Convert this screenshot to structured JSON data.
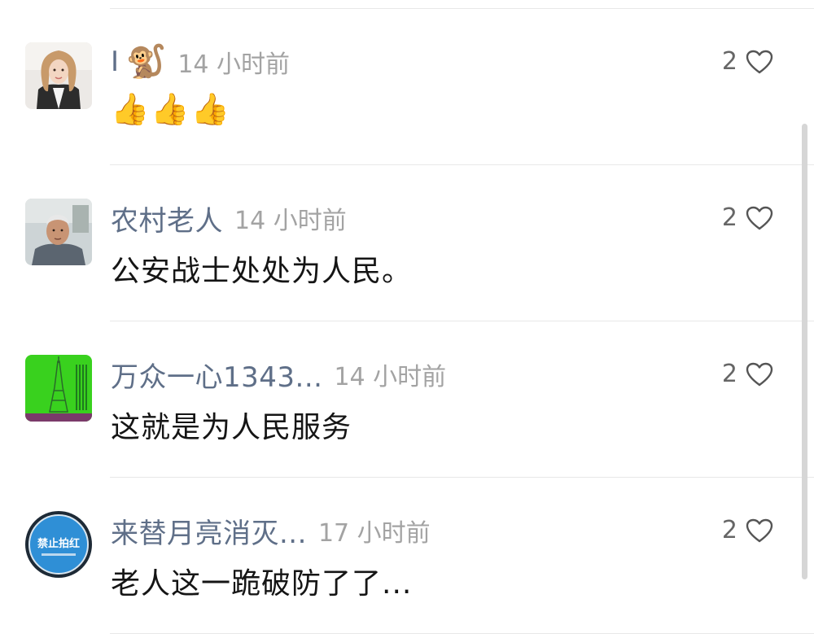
{
  "comments": [
    {
      "username": "I",
      "username_emoji": "🐒",
      "time": "14 小时前",
      "text": "👍👍👍",
      "likes": "2",
      "avatar_icon": "woman-portrait-icon"
    },
    {
      "username": "农村老人",
      "time": "14 小时前",
      "text": "公安战士处处为人民。",
      "likes": "2",
      "avatar_icon": "elderly-man-portrait-icon"
    },
    {
      "username": "万众一心1343...",
      "time": "14 小时前",
      "text": "这就是为人民服务",
      "likes": "2",
      "avatar_icon": "tower-green-icon"
    },
    {
      "username": "来替月亮消灭...",
      "time": "17 小时前",
      "text": "老人这一跪破防了了...",
      "likes": "2",
      "avatar_icon": "blue-round-sign-icon",
      "avatar_text": "禁止拍红"
    }
  ],
  "colors": {
    "username": "#5f6f88",
    "timestamp": "#a3a3a3",
    "text": "#151515",
    "divider": "#e8e8e8"
  }
}
